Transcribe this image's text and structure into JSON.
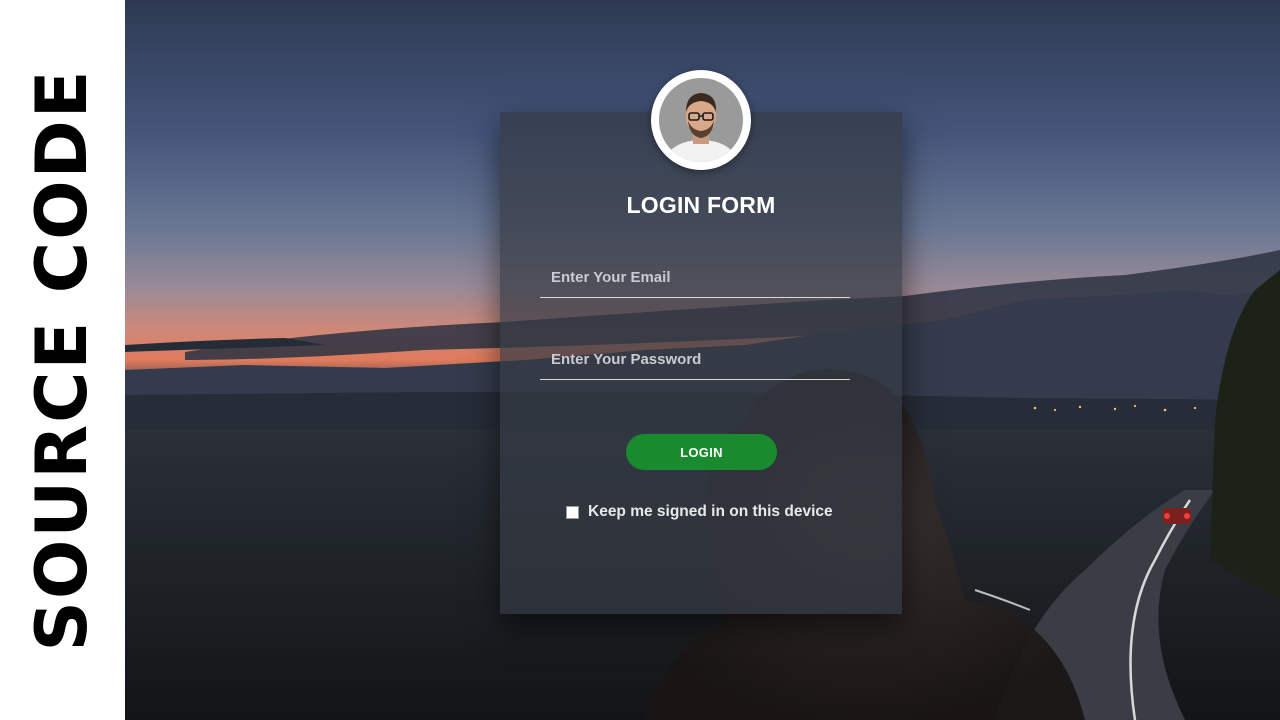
{
  "banner": {
    "text": "SOURCE CODE"
  },
  "form": {
    "title": "LOGIN FORM",
    "email_placeholder": "Enter Your Email",
    "email_value": "",
    "password_placeholder": "Enter Your Password",
    "password_value": "",
    "login_label": "LOGIN",
    "remember_label": "Keep me signed in on this device",
    "remember_checked": false
  },
  "colors": {
    "login_button": "#1a8a2e",
    "banner_background": "#ffffff",
    "banner_text": "#000000"
  },
  "icons": {
    "avatar": "user-avatar-icon"
  }
}
